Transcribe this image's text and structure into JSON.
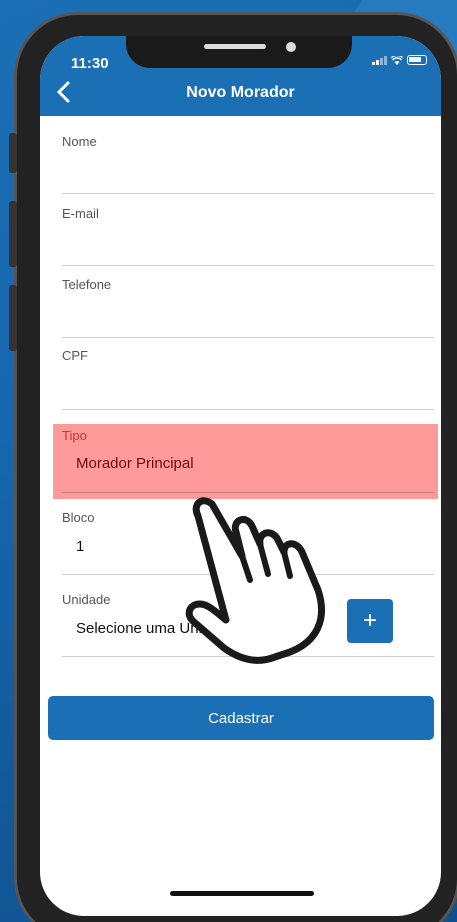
{
  "status_bar": {
    "time": "11:30"
  },
  "header": {
    "title": "Novo Morador"
  },
  "form": {
    "fields": [
      {
        "label": "Nome",
        "value": ""
      },
      {
        "label": "E-mail",
        "value": ""
      },
      {
        "label": "Telefone",
        "value": ""
      },
      {
        "label": "CPF",
        "value": ""
      },
      {
        "label": "Tipo",
        "value": "Morador Principal"
      },
      {
        "label": "Bloco",
        "value": "1"
      },
      {
        "label": "Unidade",
        "value": "Selecione uma Unidade"
      }
    ],
    "add_unit_label": "+",
    "submit_label": "Cadastrar"
  },
  "colors": {
    "brand": "#1b6fb5",
    "highlight": "#ff8f8f",
    "highlight_label": "#c0392b"
  },
  "icons": [
    "back-chevron-icon",
    "signal-icon",
    "wifi-icon",
    "battery-icon",
    "plus-icon",
    "pointing-hand-icon"
  ]
}
